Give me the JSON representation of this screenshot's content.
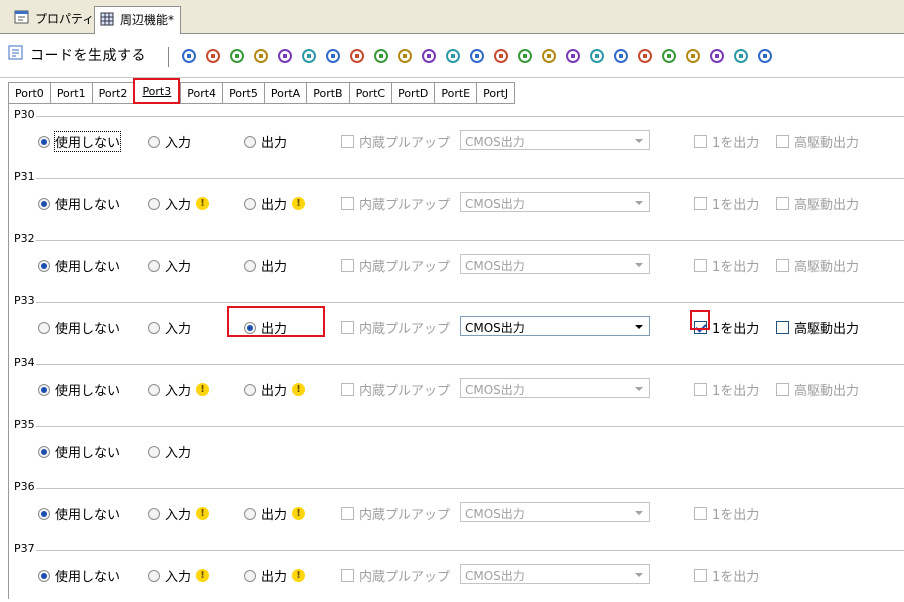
{
  "doc_tabs": {
    "properties": "プロパティ",
    "peripheral": "周辺機能*"
  },
  "toolbar": {
    "generate_label": "コードを生成する",
    "icons": [
      "hierarchy",
      "doc",
      "book",
      "table",
      "brush",
      "chip",
      "arrow",
      "tree",
      "tree2",
      "swap",
      "timer1",
      "timer2",
      "timer3",
      "timer4",
      "timer5",
      "panel",
      "link1",
      "link2",
      "grid",
      "music",
      "numbers",
      "music2",
      "plug",
      "arrow2",
      "step"
    ]
  },
  "port_tabs": [
    "Port0",
    "Port1",
    "Port2",
    "Port3",
    "Port4",
    "Port5",
    "PortA",
    "PortB",
    "PortC",
    "PortD",
    "PortE",
    "PortJ"
  ],
  "active_port_tab": "Port3",
  "labels": {
    "unused": "使用しない",
    "input": "入力",
    "output": "出力",
    "pullup": "内蔵プルアップ",
    "one_output": "1を出力",
    "high_drive": "高駆動出力"
  },
  "groups": [
    {
      "name": "P30",
      "mode": "unused",
      "input_warn": false,
      "output_warn": false,
      "has_output": true,
      "has_pullup": true,
      "has_select": true,
      "select_value": "CMOS出力",
      "select_enabled": false,
      "one_output_checked": false,
      "one_output_enabled": false,
      "has_high_drive": true,
      "focus_unused": true
    },
    {
      "name": "P31",
      "mode": "unused",
      "input_warn": true,
      "output_warn": true,
      "has_output": true,
      "has_pullup": true,
      "has_select": true,
      "select_value": "CMOS出力",
      "select_enabled": false,
      "one_output_checked": false,
      "one_output_enabled": false,
      "has_high_drive": true
    },
    {
      "name": "P32",
      "mode": "unused",
      "input_warn": false,
      "output_warn": false,
      "has_output": true,
      "has_pullup": true,
      "has_select": true,
      "select_value": "CMOS出力",
      "select_enabled": false,
      "one_output_checked": false,
      "one_output_enabled": false,
      "has_high_drive": true
    },
    {
      "name": "P33",
      "mode": "output",
      "input_warn": false,
      "output_warn": false,
      "has_output": true,
      "has_pullup": true,
      "has_select": true,
      "select_value": "CMOS出力",
      "select_enabled": true,
      "one_output_checked": true,
      "one_output_enabled": true,
      "has_high_drive": true
    },
    {
      "name": "P34",
      "mode": "unused",
      "input_warn": true,
      "output_warn": true,
      "has_output": true,
      "has_pullup": true,
      "has_select": true,
      "select_value": "CMOS出力",
      "select_enabled": false,
      "one_output_checked": false,
      "one_output_enabled": false,
      "has_high_drive": true
    },
    {
      "name": "P35",
      "mode": "unused",
      "input_warn": false,
      "output_warn": false,
      "has_output": false,
      "has_pullup": false,
      "has_select": false,
      "has_high_drive": false
    },
    {
      "name": "P36",
      "mode": "unused",
      "input_warn": true,
      "output_warn": true,
      "has_output": true,
      "has_pullup": true,
      "has_select": true,
      "select_value": "CMOS出力",
      "select_enabled": false,
      "one_output_checked": false,
      "one_output_enabled": false,
      "has_high_drive": false
    },
    {
      "name": "P37",
      "mode": "unused",
      "input_warn": true,
      "output_warn": true,
      "has_output": true,
      "has_pullup": true,
      "has_select": true,
      "select_value": "CMOS出力",
      "select_enabled": false,
      "one_output_checked": false,
      "one_output_enabled": false,
      "has_high_drive": false
    }
  ],
  "colors": {
    "highlight": "#e0141e",
    "radio_dot": "#1d4fb0",
    "warning": "#ffd50b"
  }
}
